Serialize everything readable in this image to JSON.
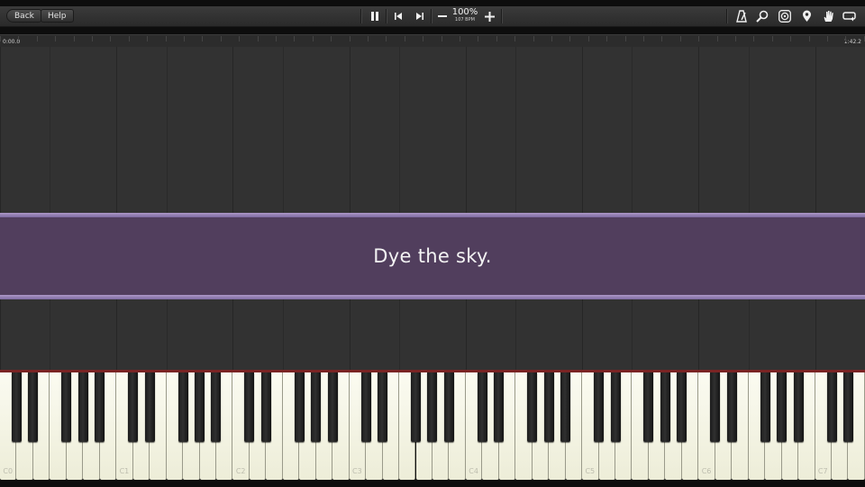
{
  "toolbar": {
    "back_label": "Back",
    "help_label": "Help",
    "speed_percent": "100%",
    "tempo": "107 BPM",
    "icons_center": [
      "pause-icon",
      "skip-back-icon",
      "skip-forward-icon",
      "minus-icon",
      "plus-icon"
    ],
    "icons_right": [
      "metronome-icon",
      "search-icon",
      "target-icon",
      "map-pin-icon",
      "hand-icon",
      "loop-icon"
    ]
  },
  "timeline": {
    "start_time": "0:00.0",
    "end_time": "1:42.2"
  },
  "lyrics": {
    "current_line": "Dye the sky."
  },
  "keyboard": {
    "octave_labels": [
      "C0",
      "C1",
      "C2",
      "C3",
      "C4",
      "C5",
      "C6",
      "C7"
    ]
  },
  "colors": {
    "banner": "#513e5d",
    "banner_edge": "#ad98c7",
    "lane_background": "#323232",
    "keyboard_edge": "#7a2424"
  }
}
